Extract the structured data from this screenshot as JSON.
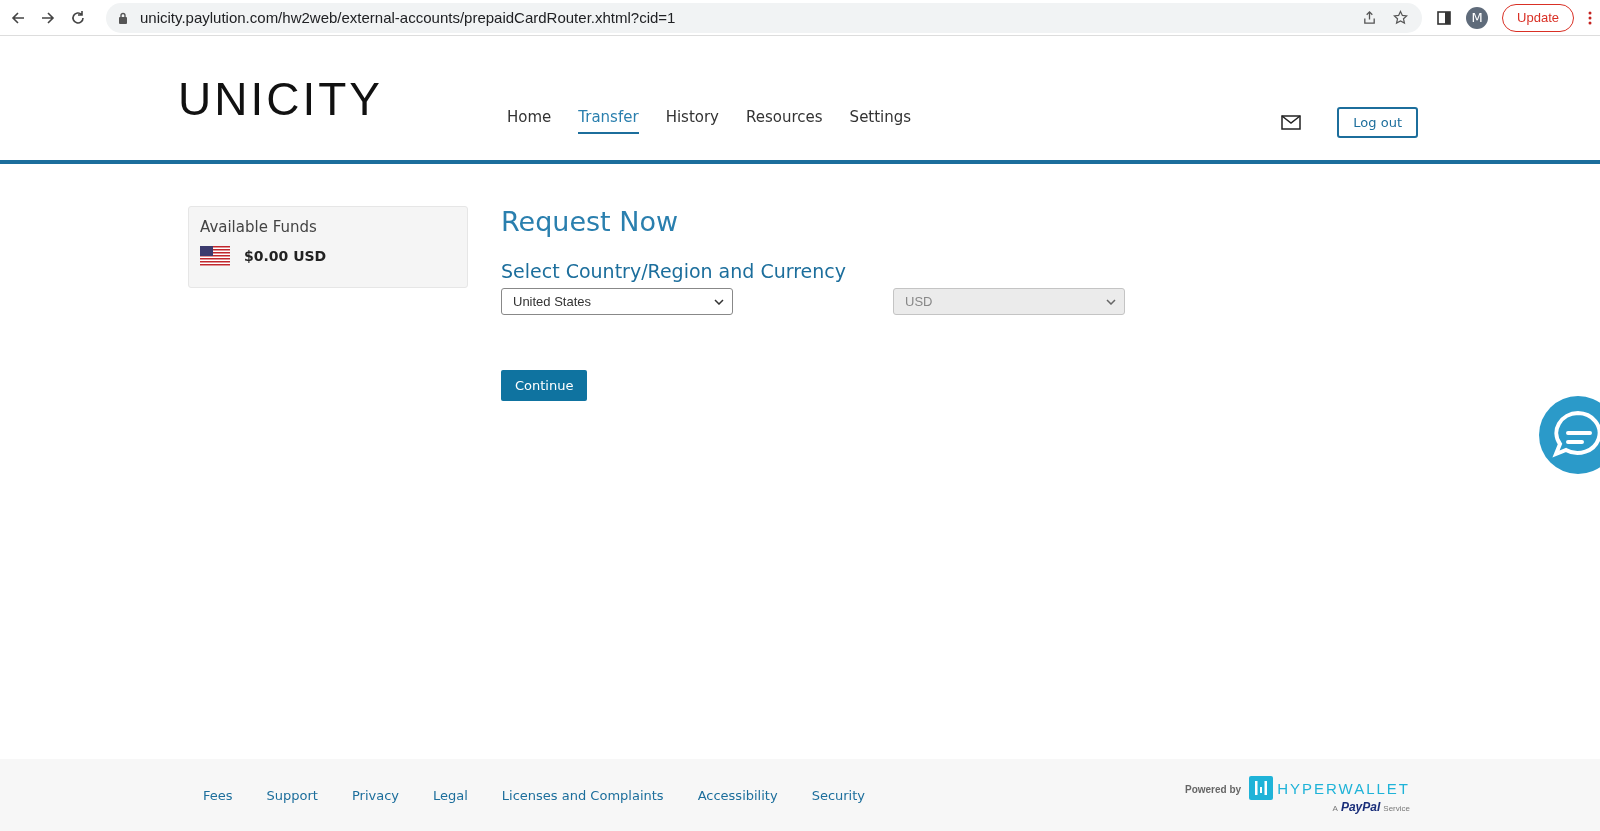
{
  "browser": {
    "url": "unicity.paylution.com/hw2web/external-accounts/prepaidCardRouter.xhtml?cid=1",
    "profile": "M",
    "update_button": "Update"
  },
  "header": {
    "logo": "UNICITY",
    "nav": [
      {
        "label": "Home",
        "selected": false
      },
      {
        "label": "Transfer",
        "selected": true
      },
      {
        "label": "History",
        "selected": false
      },
      {
        "label": "Resources",
        "selected": false
      },
      {
        "label": "Settings",
        "selected": false
      }
    ],
    "logout_button": "Log out"
  },
  "funds": {
    "title": "Available Funds",
    "amount": "$0.00 USD"
  },
  "form": {
    "title": "Request Now",
    "subtitle": "Select Country/Region and Currency",
    "country": {
      "value": "United States",
      "disabled": false
    },
    "currency": {
      "value": "USD",
      "disabled": true
    },
    "continue_button": "Continue"
  },
  "footer": {
    "links": [
      "Fees",
      "Support",
      "Privacy",
      "Legal",
      "Licenses and Complaints",
      "Accessibility",
      "Security"
    ],
    "powered_by": "Powered by",
    "brand": "HYPERWALLET",
    "tagline_prefix": "A",
    "tagline_brand": "PayPal",
    "tagline_suffix": "Service"
  }
}
